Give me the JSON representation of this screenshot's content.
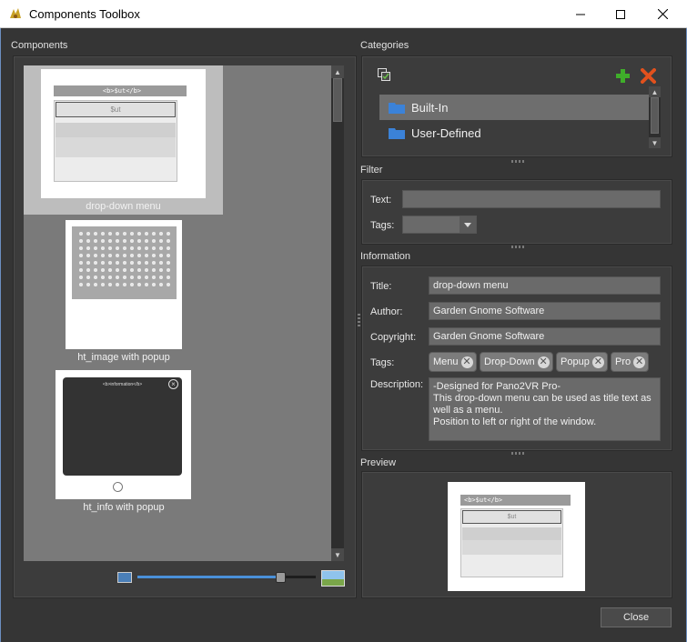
{
  "window": {
    "title": "Components Toolbox",
    "app_icon": "gnome-icon",
    "minimize_icon": "minimize-icon",
    "maximize_icon": "maximize-icon",
    "close_icon": "close-icon"
  },
  "components": {
    "section_label": "Components",
    "items": [
      {
        "caption": "drop-down menu",
        "selected": true
      },
      {
        "caption": "ht_image with popup",
        "selected": false
      },
      {
        "caption": "ht_info with popup",
        "selected": false
      }
    ],
    "thumb_dropdown_header": "<b>$ut</b>",
    "thumb_dropdown_item": "$ut",
    "thumb_info_header": "<b>information</b>",
    "zoom": {
      "min_icon": "small-image-icon",
      "max_icon": "large-image-icon",
      "level": 0.8
    }
  },
  "categories": {
    "section_label": "Categories",
    "items": [
      {
        "label": "Built-In",
        "selected": true
      },
      {
        "label": "User-Defined",
        "selected": false
      }
    ],
    "add_icon": "plus-icon",
    "remove_icon": "x-icon",
    "select_icon": "multi-select-icon"
  },
  "filter": {
    "section_label": "Filter",
    "text_label": "Text:",
    "text_value": "",
    "tags_label": "Tags:",
    "tags_value": ""
  },
  "information": {
    "section_label": "Information",
    "title_label": "Title:",
    "title_value": "drop-down menu",
    "author_label": "Author:",
    "author_value": "Garden Gnome Software",
    "copyright_label": "Copyright:",
    "copyright_value": "Garden Gnome Software",
    "tags_label": "Tags:",
    "tags": [
      "Menu",
      "Drop-Down",
      "Popup",
      "Pro"
    ],
    "description_label": "Description:",
    "description_lines": [
      "-Designed for Pano2VR Pro-",
      "This drop-down menu can be used as title text as",
      "well as a menu.",
      "Position to left or right of the window."
    ]
  },
  "preview": {
    "section_label": "Preview",
    "header": "<b>$ut</b>",
    "item": "$ut"
  },
  "footer": {
    "close_label": "Close"
  },
  "colors": {
    "accent": "#4a90d9",
    "add_green": "#3fae2a",
    "remove_orange": "#e2511d",
    "folder_blue": "#3b82d8"
  }
}
